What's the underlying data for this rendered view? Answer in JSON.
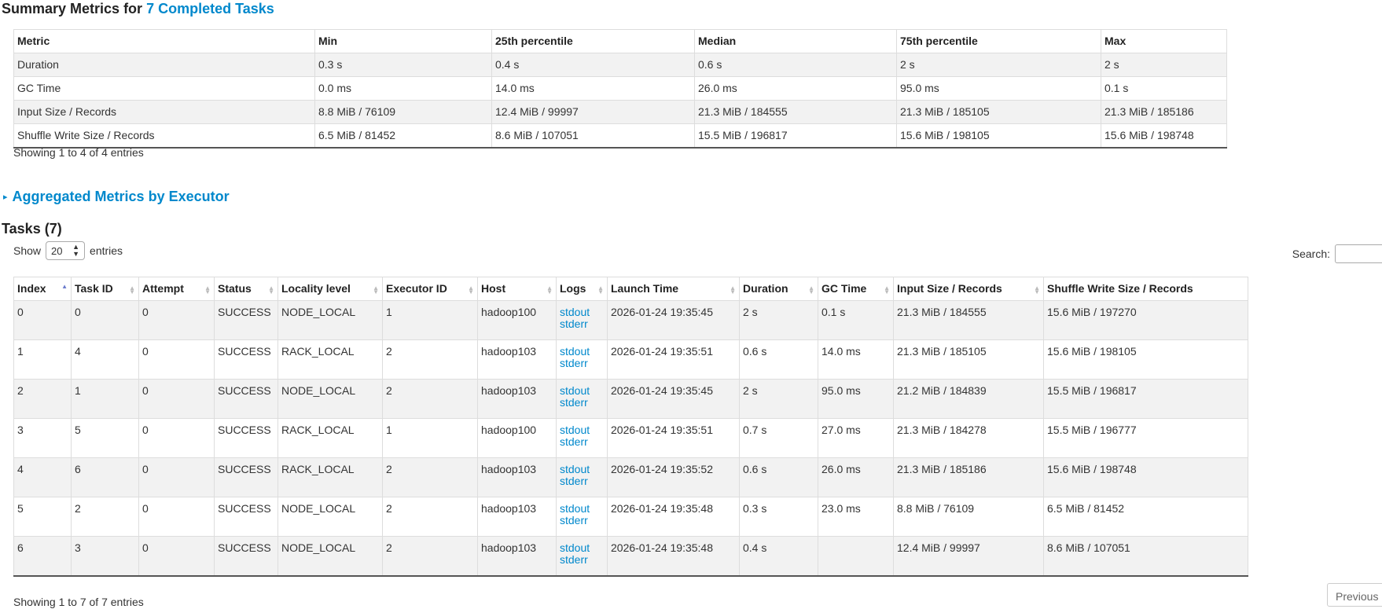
{
  "summary": {
    "title_prefix": "Summary Metrics for ",
    "title_link": "7 Completed Tasks",
    "columns": [
      "Metric",
      "Min",
      "25th percentile",
      "Median",
      "75th percentile",
      "Max"
    ],
    "rows": [
      [
        "Duration",
        "0.3 s",
        "0.4 s",
        "0.6 s",
        "2 s",
        "2 s"
      ],
      [
        "GC Time",
        "0.0 ms",
        "14.0 ms",
        "26.0 ms",
        "95.0 ms",
        "0.1 s"
      ],
      [
        "Input Size / Records",
        "8.8 MiB / 76109",
        "12.4 MiB / 99997",
        "21.3 MiB / 184555",
        "21.3 MiB / 185105",
        "21.3 MiB / 185186"
      ],
      [
        "Shuffle Write Size / Records",
        "6.5 MiB / 81452",
        "8.6 MiB / 107051",
        "15.5 MiB / 196817",
        "15.6 MiB / 198105",
        "15.6 MiB / 198748"
      ]
    ],
    "info": "Showing 1 to 4 of 4 entries"
  },
  "aggregated": {
    "title": "Aggregated Metrics by Executor"
  },
  "tasks": {
    "title": "Tasks (7)",
    "show_label": "Show",
    "page_size": "20",
    "entries_label": "entries",
    "search_label": "Search:",
    "columns": [
      "Index",
      "Task ID",
      "Attempt",
      "Status",
      "Locality level",
      "Executor ID",
      "Host",
      "Logs",
      "Launch Time",
      "Duration",
      "GC Time",
      "Input Size / Records",
      "Shuffle Write Size / Records"
    ],
    "rows": [
      [
        "0",
        "0",
        "0",
        "SUCCESS",
        "NODE_LOCAL",
        "1",
        "hadoop100",
        "",
        "2026-01-24 19:35:45",
        "2 s",
        "0.1 s",
        "21.3 MiB / 184555",
        "15.6 MiB / 197270"
      ],
      [
        "1",
        "4",
        "0",
        "SUCCESS",
        "RACK_LOCAL",
        "2",
        "hadoop103",
        "",
        "2026-01-24 19:35:51",
        "0.6 s",
        "14.0 ms",
        "21.3 MiB / 185105",
        "15.6 MiB / 198105"
      ],
      [
        "2",
        "1",
        "0",
        "SUCCESS",
        "NODE_LOCAL",
        "2",
        "hadoop103",
        "",
        "2026-01-24 19:35:45",
        "2 s",
        "95.0 ms",
        "21.2 MiB / 184839",
        "15.5 MiB / 196817"
      ],
      [
        "3",
        "5",
        "0",
        "SUCCESS",
        "RACK_LOCAL",
        "1",
        "hadoop100",
        "",
        "2026-01-24 19:35:51",
        "0.7 s",
        "27.0 ms",
        "21.3 MiB / 184278",
        "15.5 MiB / 196777"
      ],
      [
        "4",
        "6",
        "0",
        "SUCCESS",
        "RACK_LOCAL",
        "2",
        "hadoop103",
        "",
        "2026-01-24 19:35:52",
        "0.6 s",
        "26.0 ms",
        "21.3 MiB / 185186",
        "15.6 MiB / 198748"
      ],
      [
        "5",
        "2",
        "0",
        "SUCCESS",
        "NODE_LOCAL",
        "2",
        "hadoop103",
        "",
        "2026-01-24 19:35:48",
        "0.3 s",
        "23.0 ms",
        "8.8 MiB / 76109",
        "6.5 MiB / 81452"
      ],
      [
        "6",
        "3",
        "0",
        "SUCCESS",
        "NODE_LOCAL",
        "2",
        "hadoop103",
        "",
        "2026-01-24 19:35:48",
        "0.4 s",
        "",
        "12.4 MiB / 99997",
        "8.6 MiB / 107051"
      ]
    ],
    "log_links": [
      "stdout",
      "stderr"
    ],
    "info": "Showing 1 to 7 of 7 entries",
    "previous_label": "Previous"
  }
}
